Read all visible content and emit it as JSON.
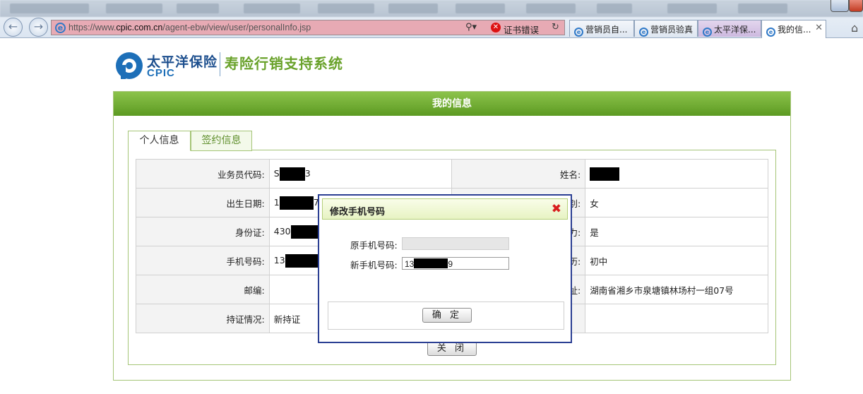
{
  "browser": {
    "url_prefix": "https://www.",
    "url_domain": "cpic.com.cn",
    "url_path": "/agent-ebw/view/user/personalInfo.jsp",
    "cert_error": "证书错误",
    "tabs": [
      {
        "label": "营销员自..."
      },
      {
        "label": "营销员验真"
      },
      {
        "label": "太平洋保..."
      },
      {
        "label": "我的信..."
      }
    ]
  },
  "header": {
    "brand_cn": "太平洋保险",
    "brand_en": "CPIC",
    "system_title": "寿险行销支持系统"
  },
  "panel": {
    "title": "我的信息",
    "tabs": [
      {
        "label": "个人信息"
      },
      {
        "label": "签约信息"
      }
    ]
  },
  "info": {
    "rows": [
      {
        "label": "业务员代码:",
        "value_prefix": "S",
        "value_suffix": "3",
        "label2": "姓名:",
        "value2": ""
      },
      {
        "label": "出生日期:",
        "value_prefix": "1",
        "value_suffix": "7",
        "label2": "别:",
        "value2": "女"
      },
      {
        "label": "身份证:",
        "value_prefix": "430",
        "value_suffix": "",
        "label2": "力:",
        "value2": "是"
      },
      {
        "label": "手机号码:",
        "value_prefix": "13",
        "value_suffix": "",
        "label2": "历:",
        "value2": "初中"
      },
      {
        "label": "邮编:",
        "value_prefix": "",
        "value_suffix": "",
        "label2": "址:",
        "value2": "湖南省湘乡市泉塘镇林场村一组07号"
      },
      {
        "label": "持证情况:",
        "value_prefix": "新持证",
        "value_suffix": "",
        "label2": "",
        "value2": ""
      }
    ],
    "close_label": "关 闭"
  },
  "dialog": {
    "title": "修改手机号码",
    "old_label": "原手机号码:",
    "old_value": "",
    "new_label": "新手机号码:",
    "new_prefix": "13",
    "new_suffix": "9",
    "confirm_label": "确 定"
  }
}
